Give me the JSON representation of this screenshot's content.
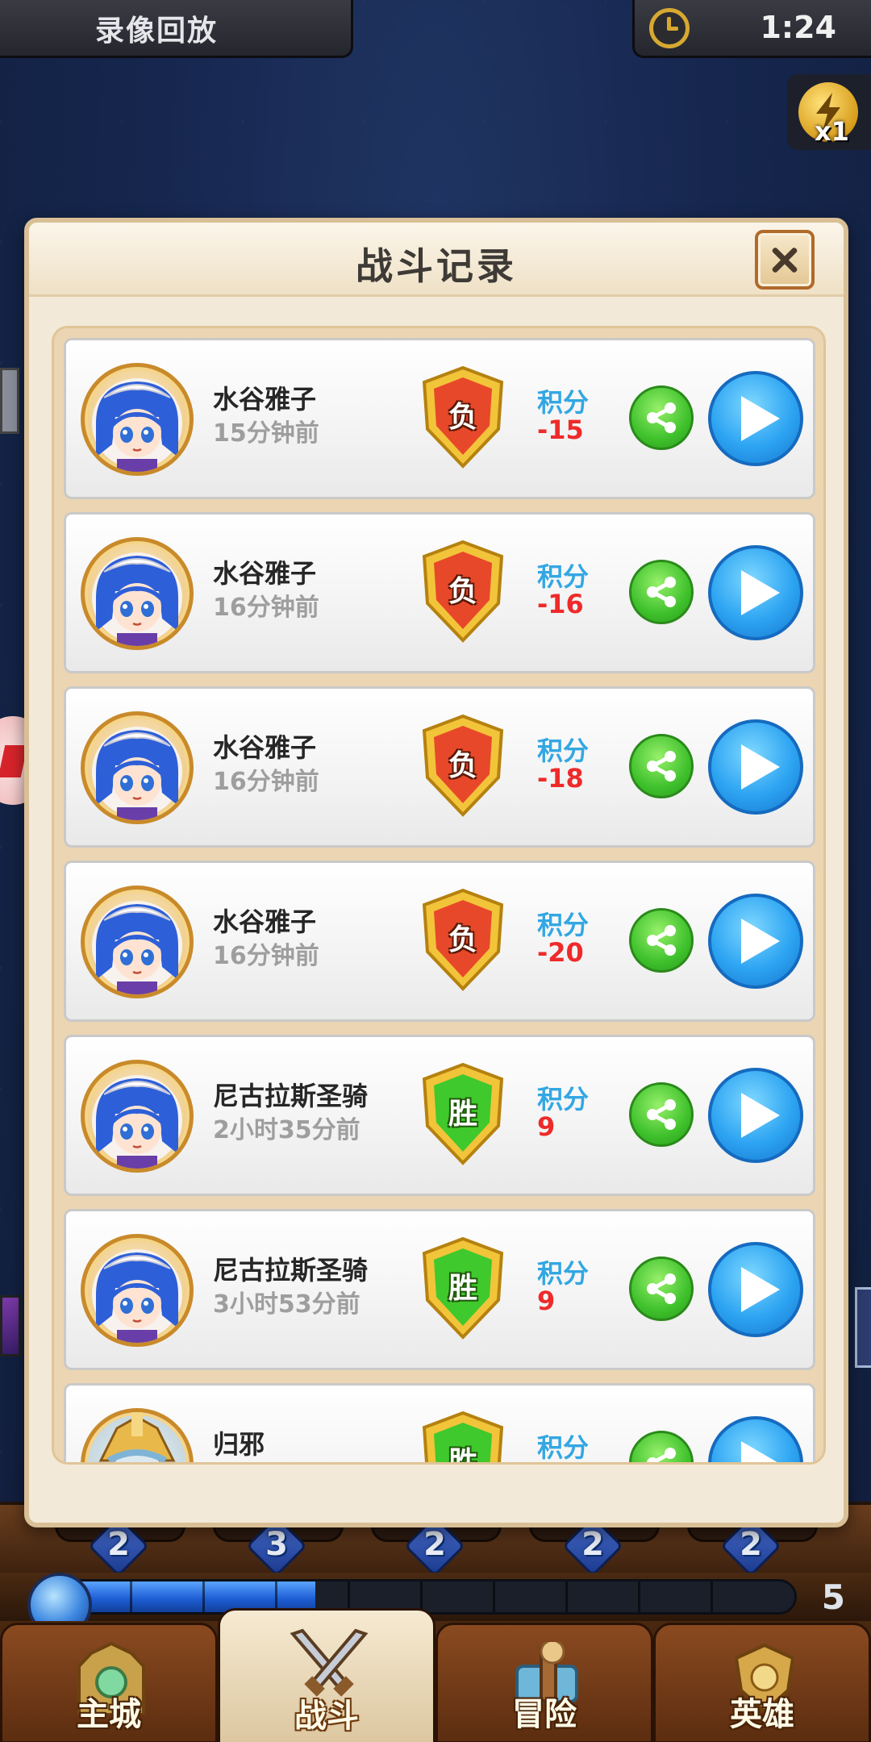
{
  "top_bar": {
    "replay_title": "录像回放",
    "timer": "1:24",
    "speed": "x1"
  },
  "modal": {
    "title": "战斗记录",
    "score_label": "积分",
    "records": [
      {
        "name": "水谷雅子",
        "time": "15分钟前",
        "result": "负",
        "score": "-15",
        "avatar": "blue-hair-girl"
      },
      {
        "name": "水谷雅子",
        "time": "16分钟前",
        "result": "负",
        "score": "-16",
        "avatar": "blue-hair-girl"
      },
      {
        "name": "水谷雅子",
        "time": "16分钟前",
        "result": "负",
        "score": "-18",
        "avatar": "blue-hair-girl"
      },
      {
        "name": "水谷雅子",
        "time": "16分钟前",
        "result": "负",
        "score": "-20",
        "avatar": "blue-hair-girl"
      },
      {
        "name": "尼古拉斯圣骑",
        "time": "2小时35分前",
        "result": "胜",
        "score": "9",
        "avatar": "blue-hair-girl"
      },
      {
        "name": "尼古拉斯圣骑",
        "time": "3小时53分前",
        "result": "胜",
        "score": "9",
        "avatar": "blue-hair-girl"
      },
      {
        "name": "归邪",
        "time": "",
        "result": "胜",
        "score": "",
        "avatar": "crowned-knight"
      }
    ]
  },
  "slots": [
    "2",
    "3",
    "2",
    "2",
    "2"
  ],
  "mana": {
    "count": "5",
    "filled_fraction": 0.35
  },
  "tabs": [
    {
      "label": "主城",
      "icon": "castle-icon",
      "active": false
    },
    {
      "label": "战斗",
      "icon": "crossed-swords-icon",
      "active": true
    },
    {
      "label": "冒险",
      "icon": "map-scroll-icon",
      "active": false
    },
    {
      "label": "英雄",
      "icon": "hero-crest-icon",
      "active": false
    }
  ],
  "colors": {
    "loss_shield": "#e8482a",
    "win_shield": "#3fc92c",
    "score_label": "#33a7e3",
    "score_value": "#ee2a2a",
    "share": "#3fc12c",
    "play": "#2da4f2"
  }
}
